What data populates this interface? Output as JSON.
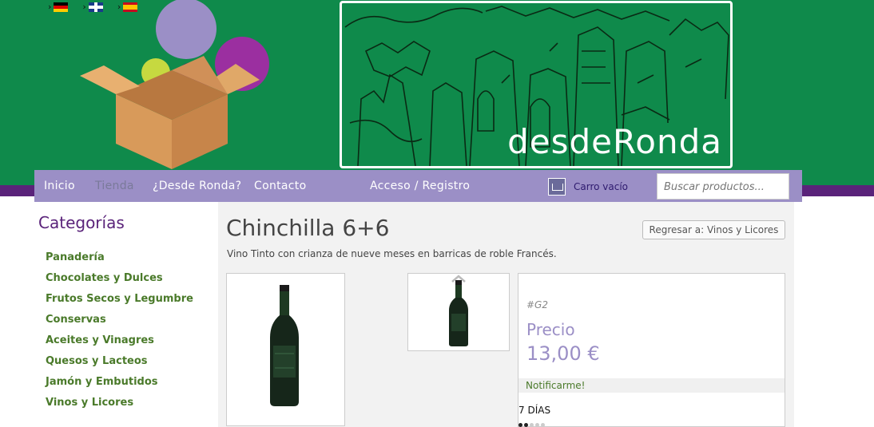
{
  "languages": [
    {
      "name": "Deutsch",
      "icon": "flag-de-icon"
    },
    {
      "name": "English",
      "icon": "flag-en-icon"
    },
    {
      "name": "Español",
      "icon": "flag-es-icon"
    }
  ],
  "banner": {
    "title": "desdeRonda"
  },
  "nav": {
    "items": [
      "Inicio",
      "Tienda",
      "¿Desde Ronda?",
      "Contacto"
    ],
    "account": "Acceso / Registro",
    "cart_label": "Carro vacío",
    "search_placeholder": "Buscar productos..."
  },
  "sidebar": {
    "title": "Categorías",
    "categories": [
      "Panadería",
      "Chocolates y Dulces",
      "Frutos Secos y Legumbre",
      "Conservas",
      "Aceites y Vinagres",
      "Quesos y Lacteos",
      "Jamón y Embutidos",
      "Vinos y Licores"
    ]
  },
  "product": {
    "title": "Chinchilla 6+6",
    "back_label": "Regresar a: Vinos y Licores",
    "description": "Vino Tinto con crianza de nueve meses en barricas de roble Francés.",
    "sku": "#G2",
    "price_label": "Precio",
    "price": "13,00 €",
    "notify_label": "Notificarme!",
    "delivery": "7 DÍAS"
  },
  "colors": {
    "header_green": "#0f8a4b",
    "nav_purple": "#9b8fc6",
    "accent_purple": "#5a237a",
    "category_green": "#4a7a2a"
  }
}
